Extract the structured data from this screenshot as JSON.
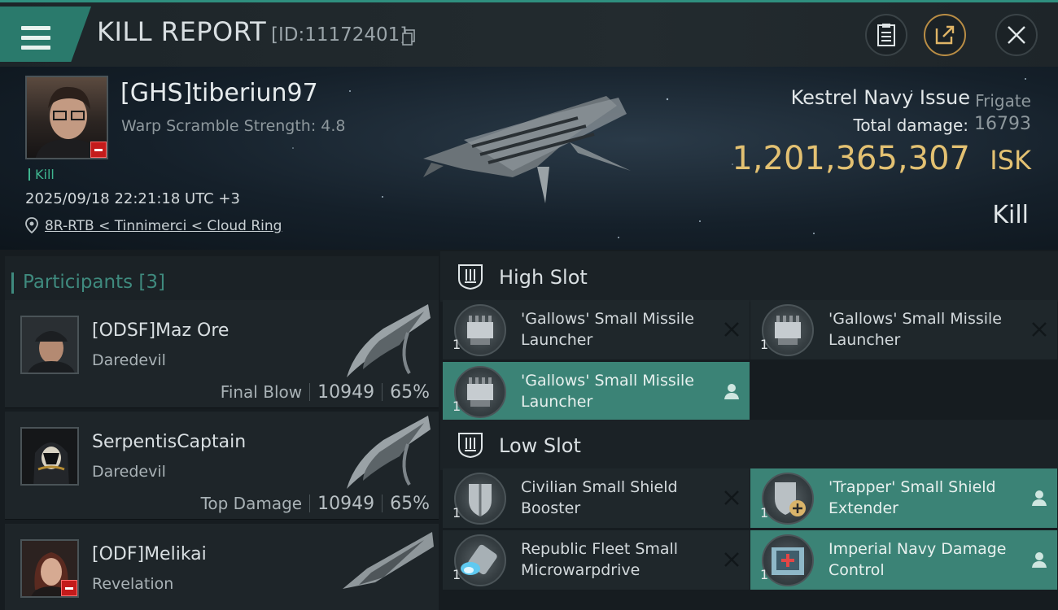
{
  "topbar": {
    "title": "KILL REPORT",
    "report_id": "[ID:11172401]"
  },
  "victim": {
    "name": "[GHS]tiberiun97",
    "warp_scramble": "Warp Scramble Strength: 4.8",
    "kill_tag": "Kill",
    "datetime": "2025/09/18 22:21:18 UTC +3",
    "location": "8R-RTB < Tinnimerci < Cloud Ring"
  },
  "ship": {
    "name": "Kestrel Navy Issue",
    "class": "Frigate",
    "damage_label": "Total damage:",
    "damage_value": "16793",
    "isk_value": "1,201,365,307",
    "isk_unit": "ISK",
    "result": "Kill"
  },
  "participants": {
    "title": "Participants [3]",
    "list": [
      {
        "name": "[ODSF]Maz Ore",
        "ship": "Daredevil",
        "role": "Final Blow",
        "damage": "10949",
        "percent": "65%"
      },
      {
        "name": "SerpentisCaptain",
        "ship": "Daredevil",
        "role": "Top Damage",
        "damage": "10949",
        "percent": "65%"
      },
      {
        "name": "[ODF]Melikai",
        "ship": "Revelation"
      }
    ]
  },
  "fitting": {
    "high_slot": {
      "title": "High Slot",
      "modules": [
        {
          "name": "'Gallows' Small Missile Launcher",
          "qty": "1",
          "status": "destroyed"
        },
        {
          "name": "'Gallows' Small Missile Launcher",
          "qty": "1",
          "status": "destroyed"
        },
        {
          "name": "'Gallows' Small Missile Launcher",
          "qty": "1",
          "status": "dropped"
        }
      ]
    },
    "low_slot": {
      "title": "Low Slot",
      "modules": [
        {
          "name": "Civilian Small Shield Booster",
          "qty": "1",
          "status": "destroyed"
        },
        {
          "name": "'Trapper' Small Shield Extender",
          "qty": "1",
          "status": "dropped"
        },
        {
          "name": "Republic Fleet Small Microwarpdrive",
          "qty": "1",
          "status": "destroyed"
        },
        {
          "name": "Imperial Navy Damage Control",
          "qty": "1",
          "status": "dropped"
        }
      ]
    }
  },
  "colors": {
    "accent": "#2f8f7f",
    "isk_gold": "#e3c172",
    "dropped_bg": "#3b8376",
    "kill_green": "#3fb58f",
    "badge_red": "#c41b1b"
  },
  "icons": [
    "menu-icon",
    "copy-icon",
    "clipboard-icon",
    "share-icon",
    "close-icon",
    "location-pin-icon",
    "slot-icon",
    "destroyed-x-icon",
    "pilot-icon",
    "minus-badge-icon"
  ]
}
